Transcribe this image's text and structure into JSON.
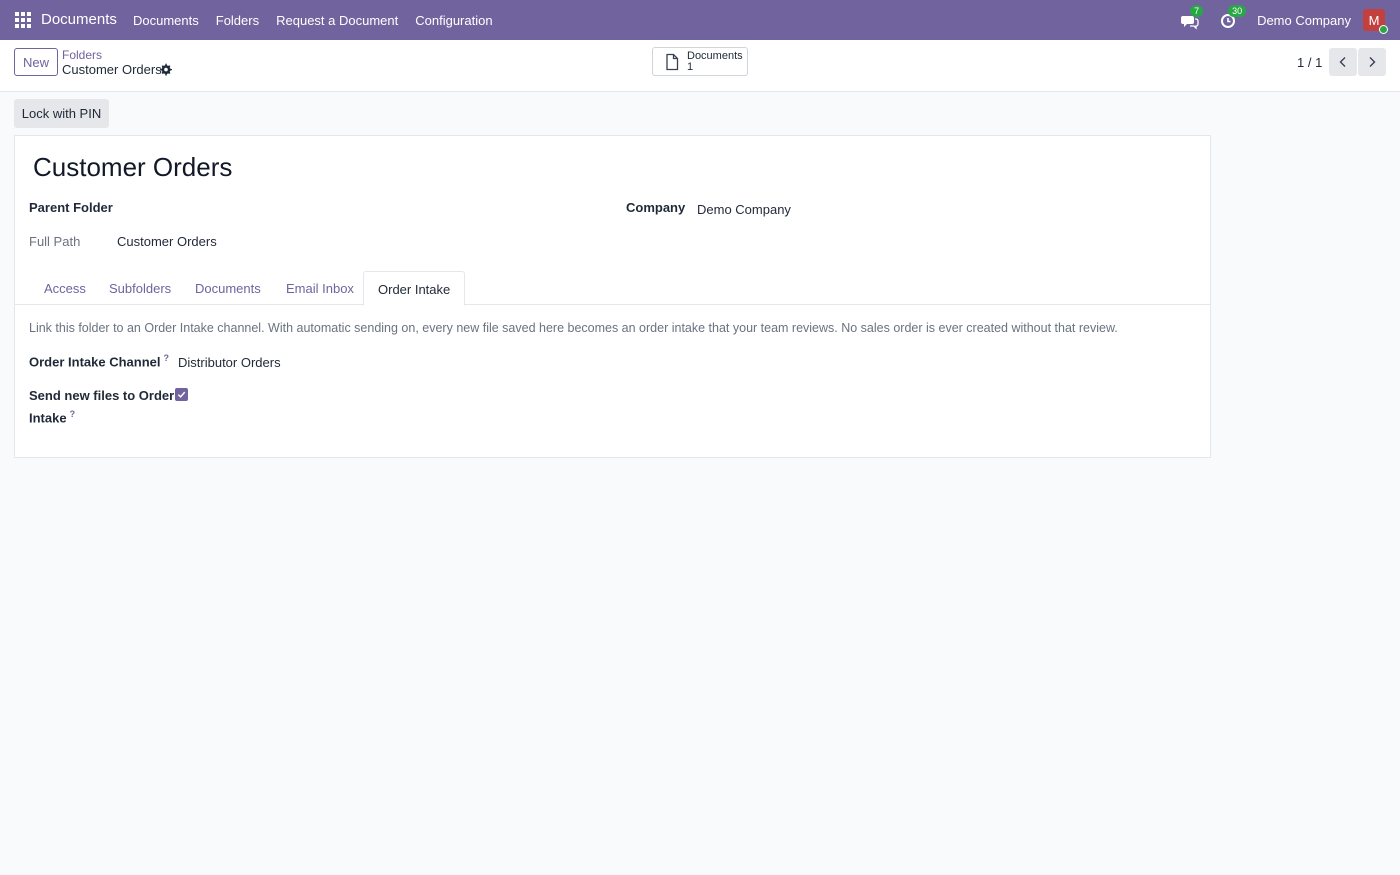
{
  "navbar": {
    "app_name": "Documents",
    "menu": [
      "Documents",
      "Folders",
      "Request a Document",
      "Configuration"
    ],
    "messages_count": "7",
    "activities_count": "30",
    "company": "Demo Company",
    "avatar_initial": "M"
  },
  "control_panel": {
    "new_label": "New",
    "breadcrumb_parent": "Folders",
    "breadcrumb_current": "Customer Orders",
    "smart_button": {
      "label": "Documents",
      "count": "1"
    },
    "pager": "1 / 1"
  },
  "actions": {
    "lock_label": "Lock with PIN"
  },
  "form": {
    "title": "Customer Orders",
    "parent_folder_label": "Parent Folder",
    "company_label": "Company",
    "company_value": "Demo Company",
    "full_path_label": "Full Path",
    "full_path_value": "Customer Orders",
    "tabs": [
      "Access",
      "Subfolders",
      "Documents",
      "Email Inbox",
      "Order Intake"
    ],
    "active_tab": "Order Intake",
    "order_intake": {
      "description": "Link this folder to an Order Intake channel. With automatic sending on, every new file saved here becomes an order intake that your team reviews. No sales order is ever created without that review.",
      "channel_label": "Order Intake Channel",
      "channel_value": "Distributor Orders",
      "send_label_line1": "Send new files to Order",
      "send_label_line2": "Intake",
      "send_checked": true,
      "help_mark": "?"
    }
  },
  "colors": {
    "brand": "#71639e",
    "badge": "#28a745",
    "avatar": "#c2403e"
  }
}
